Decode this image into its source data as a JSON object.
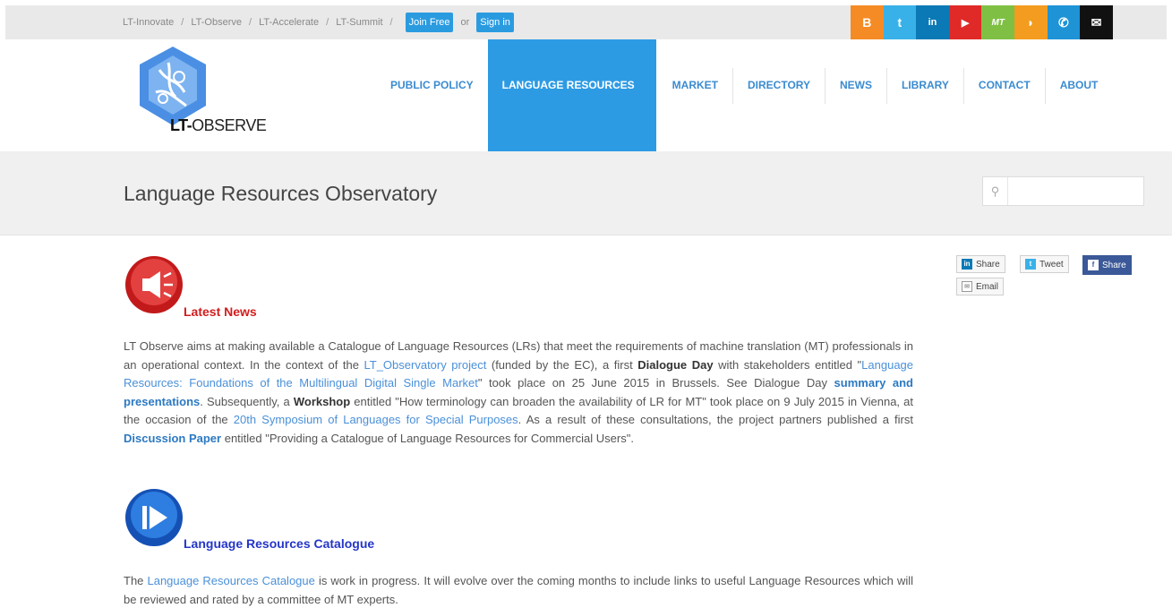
{
  "topbar": {
    "crumbs": [
      "LT-Innovate",
      "LT-Observe",
      "LT-Accelerate",
      "LT-Summit"
    ],
    "join_label": "Join Free",
    "or_label": "or",
    "signin_label": "Sign in",
    "social": [
      {
        "name": "blogger-icon",
        "glyph": "B",
        "color": "#f58b25"
      },
      {
        "name": "twitter-icon",
        "glyph": "t",
        "color": "#38b1e8"
      },
      {
        "name": "linkedin-icon",
        "glyph": "in",
        "color": "#0b79b5"
      },
      {
        "name": "youtube-icon",
        "glyph": "▶",
        "color": "#e02a28"
      },
      {
        "name": "mt-icon",
        "glyph": "MT",
        "color": "#7fc044"
      },
      {
        "name": "rss-icon",
        "glyph": "◗",
        "color": "#f39c1f"
      },
      {
        "name": "phone-icon",
        "glyph": "✆",
        "color": "#1e93d6"
      },
      {
        "name": "mail-icon",
        "glyph": "✉",
        "color": "#111111"
      }
    ]
  },
  "logo": {
    "text_strong": "LT-",
    "text_rest": "OBSERVE"
  },
  "nav": [
    "PUBLIC POLICY",
    "LANGUAGE RESOURCES",
    "MARKET",
    "DIRECTORY",
    "NEWS",
    "LIBRARY",
    "CONTACT",
    "ABOUT"
  ],
  "nav_active": "LANGUAGE RESOURCES",
  "page_title": "Language Resources Observatory",
  "search": {
    "placeholder": ""
  },
  "share": {
    "linkedin": "Share",
    "twitter": "Tweet",
    "facebook": "Share",
    "email": "Email"
  },
  "latest_news": {
    "heading": "Latest News",
    "p1": "LT Observe aims at making available a Catalogue of Language Resources (LRs) that meet the requirements of machine translation (MT) professionals in an operational context. In the context of the ",
    "link1": "LT_Observatory project",
    "p2": " (funded by the EC), a first ",
    "b1": "Dialogue Day",
    "p3": " with stakeholders entitled \"",
    "link2": "Language Resources: Foundations of the Multilingual Digital Single Market",
    "p4": "\" took place on 25 June 2015 in Brussels. See Dialogue Day ",
    "link3": "summary and presentations",
    "p5": ". Subsequently, a ",
    "b2": "Workshop",
    "p6": " entitled \"How terminology can broaden the availability of LR for MT\" took place on 9 July 2015 in Vienna, at the occasion of the ",
    "link4": "20th Symposium of Languages for Special Purposes",
    "p7": ". As a result of these consultations, the project partners published a first ",
    "link5": "Discussion Paper",
    "p8": " entitled \"Providing a Catalogue of Language Resources for Commercial Users\"."
  },
  "catalogue": {
    "heading": "Language Resources Catalogue",
    "t1": "The ",
    "link": "Language Resources Catalogue",
    "t2": " is work in progress.  It will evolve over the coming months to include links to useful Language Resources which will be reviewed and rated by a committee of MT experts."
  }
}
